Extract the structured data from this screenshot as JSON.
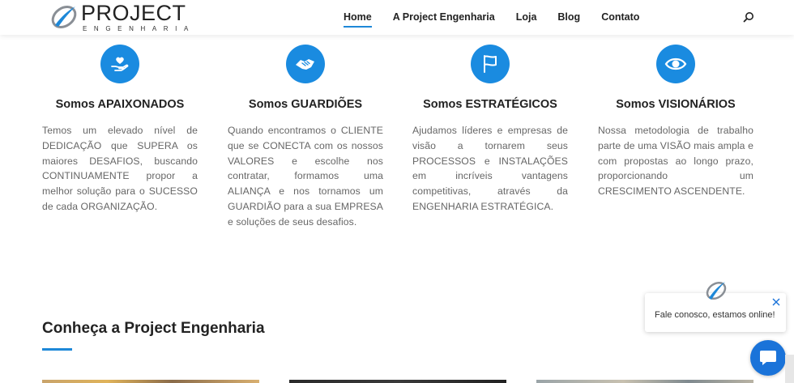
{
  "header": {
    "logo_name": "PROJECT",
    "logo_sub": "ENGENHARIA",
    "nav": [
      "Home",
      "A Project Engenharia",
      "Loja",
      "Blog",
      "Contato"
    ],
    "active_nav": "Home",
    "search_icon": "search-icon"
  },
  "features": [
    {
      "icon": "hand-heart-icon",
      "title": "Somos APAIXONADOS",
      "text": "Temos um elevado nível de DEDICAÇÃO que SUPERA os maiores DESAFIOS, buscando CONTINUAMENTE propor a melhor solução para o SUCESSO de cada ORGANIZAÇÃO."
    },
    {
      "icon": "handshake-icon",
      "title": "Somos GUARDIÕES",
      "text": "Quando encontramos o CLIENTE que se CONECTA com os nossos VALORES e escolhe nos contratar, formamos uma ALIANÇA e nos tornamos um GUARDIÃO para a sua EMPRESA e soluções de seus desafios."
    },
    {
      "icon": "flag-icon",
      "title": "Somos ESTRATÉGICOS",
      "text": "Ajudamos líderes e empresas de visão a tornarem seus PROCESSOS e INSTALAÇÕES em incríveis vantagens competitivas, através da ENGENHARIA ESTRATÉGICA."
    },
    {
      "icon": "eye-icon",
      "title": "Somos VISIONÁRIOS",
      "text": "Nossa metodologia de trabalho parte de uma VISÃO mais ampla e com propostas ao longo prazo, proporcionando um CRESCIMENTO ASCENDENTE."
    }
  ],
  "section": {
    "title": "Conheça a Project Engenharia"
  },
  "chat": {
    "message": "Fale conosco, estamos online!",
    "icons": [
      "close-icon",
      "chat-icon"
    ]
  },
  "colors": {
    "accent": "#1a8be0",
    "chat_button": "#1a73d9"
  }
}
